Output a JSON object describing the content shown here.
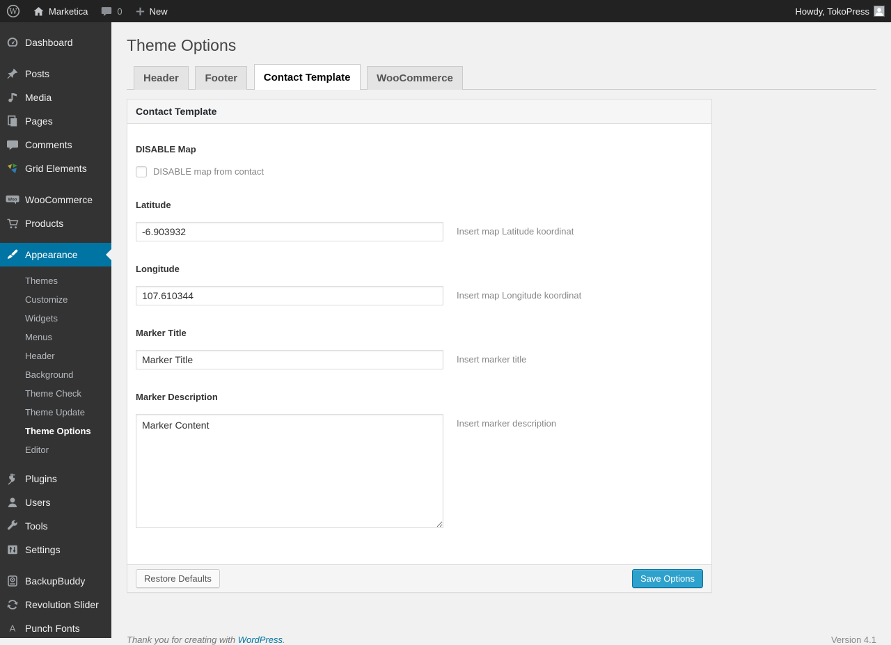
{
  "colors": {
    "accent_blue": "#0074a2",
    "primary_button_blue": "#2ea2cc",
    "adminbar_bg": "#222222",
    "sidebar_bg": "#333333",
    "content_bg": "#f1f1f1"
  },
  "admin_bar": {
    "wp_logo_text": "W",
    "site_name": "Marketica",
    "comment_count": "0",
    "new_label": "New",
    "howdy": "Howdy, TokoPress"
  },
  "sidebar": {
    "items": [
      {
        "label": "Dashboard"
      },
      {
        "label": "Posts"
      },
      {
        "label": "Media"
      },
      {
        "label": "Pages"
      },
      {
        "label": "Comments"
      },
      {
        "label": "Grid Elements"
      },
      {
        "label": "WooCommerce"
      },
      {
        "label": "Products"
      },
      {
        "label": "Appearance"
      },
      {
        "label": "Plugins"
      },
      {
        "label": "Users"
      },
      {
        "label": "Tools"
      },
      {
        "label": "Settings"
      },
      {
        "label": "BackupBuddy"
      },
      {
        "label": "Revolution Slider"
      },
      {
        "label": "Punch Fonts"
      }
    ],
    "appearance_submenu": [
      "Themes",
      "Customize",
      "Widgets",
      "Menus",
      "Header",
      "Background",
      "Theme Check",
      "Theme Update",
      "Theme Options",
      "Editor"
    ],
    "current_submenu_item": "Theme Options",
    "woo_icon_text": "Woo",
    "punch_fonts_icon_text": "A"
  },
  "page": {
    "title": "Theme Options",
    "tabs": [
      {
        "label": "Header",
        "active": false
      },
      {
        "label": "Footer",
        "active": false
      },
      {
        "label": "Contact Template",
        "active": true
      },
      {
        "label": "WooCommerce",
        "active": false
      }
    ],
    "panel": {
      "title": "Contact Template",
      "fields": {
        "disable_map": {
          "label": "DISABLE Map",
          "checkbox_label": "DISABLE map from contact",
          "checked": false
        },
        "latitude": {
          "label": "Latitude",
          "value": "-6.903932",
          "hint": "Insert map Latitude koordinat"
        },
        "longitude": {
          "label": "Longitude",
          "value": "107.610344",
          "hint": "Insert map Longitude koordinat"
        },
        "marker_title": {
          "label": "Marker Title",
          "value": "Marker Title",
          "hint": "Insert marker title"
        },
        "marker_description": {
          "label": "Marker Description",
          "value": "Marker Content",
          "hint": "Insert marker description"
        }
      },
      "restore_button": "Restore Defaults",
      "save_button": "Save Options"
    }
  },
  "footer": {
    "thanks_prefix": "Thank you for creating with ",
    "wordpress_link": "WordPress",
    "thanks_suffix": ".",
    "version": "Version 4.1"
  }
}
